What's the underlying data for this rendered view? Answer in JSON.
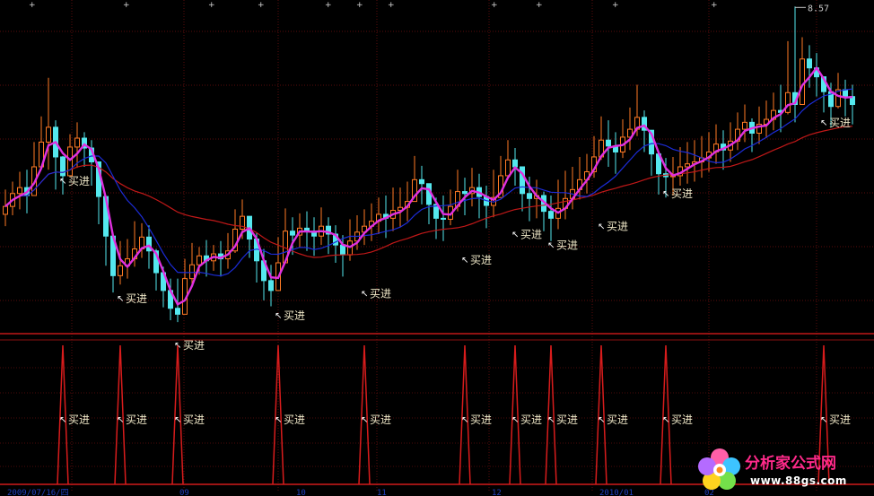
{
  "chart_data": {
    "type": "candlestick",
    "max_price_label": "8.57",
    "signal_label": "买进",
    "date_labels": [
      "2009/07/16/四",
      "09",
      "10",
      "11",
      "12",
      "2010/01",
      "02"
    ],
    "buy_signals": [
      {
        "index": 8,
        "price": 6.96
      },
      {
        "index": 16,
        "price": 5.77
      },
      {
        "index": 24,
        "price": 5.3
      },
      {
        "index": 38,
        "price": 5.6
      },
      {
        "index": 50,
        "price": 5.82
      },
      {
        "index": 64,
        "price": 6.16
      },
      {
        "index": 71,
        "price": 6.42
      },
      {
        "index": 76,
        "price": 6.31
      },
      {
        "index": 83,
        "price": 6.5
      },
      {
        "index": 92,
        "price": 6.83
      },
      {
        "index": 114,
        "price": 7.55
      }
    ],
    "closes": [
      6.55,
      6.68,
      6.74,
      6.66,
      6.95,
      7.2,
      7.35,
      7.05,
      6.86,
      7.15,
      7.24,
      7.14,
      7.0,
      6.65,
      6.25,
      5.85,
      5.95,
      6.02,
      6.12,
      6.24,
      6.1,
      5.88,
      5.7,
      5.52,
      5.46,
      5.82,
      5.96,
      6.05,
      6.0,
      6.07,
      6.02,
      6.1,
      6.32,
      6.45,
      6.22,
      6.0,
      5.8,
      5.7,
      5.98,
      6.3,
      6.26,
      6.33,
      6.3,
      6.25,
      6.35,
      6.27,
      6.16,
      6.06,
      6.2,
      6.29,
      6.35,
      6.4,
      6.47,
      6.43,
      6.51,
      6.54,
      6.6,
      6.82,
      6.78,
      6.57,
      6.43,
      6.42,
      6.55,
      6.7,
      6.68,
      6.74,
      6.65,
      6.56,
      6.64,
      6.86,
      7.02,
      6.95,
      6.68,
      6.63,
      6.66,
      6.5,
      6.43,
      6.53,
      6.63,
      6.72,
      6.82,
      6.9,
      7.05,
      7.22,
      7.16,
      7.1,
      7.25,
      7.33,
      7.45,
      7.32,
      7.08,
      6.88,
      6.85,
      6.86,
      6.95,
      6.98,
      7.0,
      7.04,
      7.1,
      7.18,
      7.12,
      7.21,
      7.33,
      7.4,
      7.29,
      7.38,
      7.43,
      7.52,
      7.5,
      7.7,
      7.58,
      8.04,
      7.95,
      7.86,
      7.71,
      7.56,
      7.73,
      7.66,
      7.58
    ],
    "highs": [
      6.72,
      6.8,
      6.9,
      6.92,
      7.2,
      7.46,
      7.85,
      7.42,
      7.06,
      7.28,
      7.4,
      7.3,
      7.22,
      6.98,
      6.6,
      6.18,
      6.2,
      6.22,
      6.4,
      6.38,
      6.36,
      6.12,
      5.94,
      5.82,
      5.82,
      6.02,
      6.18,
      6.14,
      6.21,
      6.16,
      6.2,
      6.28,
      6.52,
      6.62,
      6.42,
      6.28,
      6.12,
      5.96,
      6.24,
      6.53,
      6.44,
      6.48,
      6.5,
      6.44,
      6.54,
      6.44,
      6.36,
      6.26,
      6.42,
      6.46,
      6.52,
      6.58,
      6.64,
      6.66,
      6.74,
      6.74,
      6.8,
      7.06,
      6.96,
      6.78,
      6.64,
      6.66,
      6.72,
      6.92,
      6.84,
      6.94,
      6.88,
      6.76,
      6.92,
      7.06,
      7.22,
      7.14,
      6.92,
      6.85,
      6.82,
      6.7,
      6.66,
      6.82,
      6.91,
      6.95,
      7.05,
      7.08,
      7.26,
      7.46,
      7.42,
      7.3,
      7.43,
      7.55,
      7.78,
      7.52,
      7.3,
      7.1,
      7.04,
      7.05,
      7.15,
      7.2,
      7.22,
      7.26,
      7.3,
      7.38,
      7.32,
      7.4,
      7.5,
      7.58,
      7.44,
      7.56,
      7.62,
      7.7,
      7.78,
      8.22,
      8.57,
      8.26,
      8.18,
      8.1,
      7.86,
      7.8,
      7.9,
      7.83,
      7.78
    ],
    "lows": [
      6.35,
      6.46,
      6.52,
      6.48,
      6.72,
      6.98,
      6.92,
      6.72,
      6.67,
      6.93,
      6.94,
      6.95,
      6.76,
      6.37,
      5.95,
      5.68,
      5.76,
      5.82,
      5.94,
      6.03,
      5.92,
      5.7,
      5.53,
      5.4,
      5.38,
      5.58,
      5.76,
      5.86,
      5.84,
      5.9,
      5.84,
      5.92,
      6.08,
      6.22,
      6.03,
      5.78,
      5.6,
      5.54,
      5.76,
      6.07,
      6.06,
      6.13,
      6.1,
      6.05,
      6.16,
      6.07,
      5.98,
      5.84,
      6.0,
      6.11,
      6.16,
      6.2,
      6.27,
      6.23,
      6.3,
      6.34,
      6.4,
      6.6,
      6.57,
      6.37,
      6.22,
      6.2,
      6.36,
      6.5,
      6.46,
      6.55,
      6.43,
      6.33,
      6.44,
      6.68,
      6.82,
      6.76,
      6.5,
      6.4,
      6.43,
      6.3,
      6.2,
      6.32,
      6.42,
      6.52,
      6.62,
      6.68,
      6.84,
      7.02,
      6.95,
      6.88,
      7.04,
      7.12,
      7.26,
      7.1,
      6.86,
      6.67,
      6.64,
      6.66,
      6.76,
      6.78,
      6.8,
      6.84,
      6.9,
      6.98,
      6.92,
      7.0,
      7.12,
      7.2,
      7.1,
      7.18,
      7.24,
      7.32,
      7.3,
      7.48,
      7.4,
      7.82,
      7.75,
      7.66,
      7.5,
      7.36,
      7.54,
      7.46,
      7.38
    ]
  },
  "watermark": {
    "title": "分析家公式网",
    "url": "www.88gs.com",
    "color": "#ff2a8a"
  }
}
